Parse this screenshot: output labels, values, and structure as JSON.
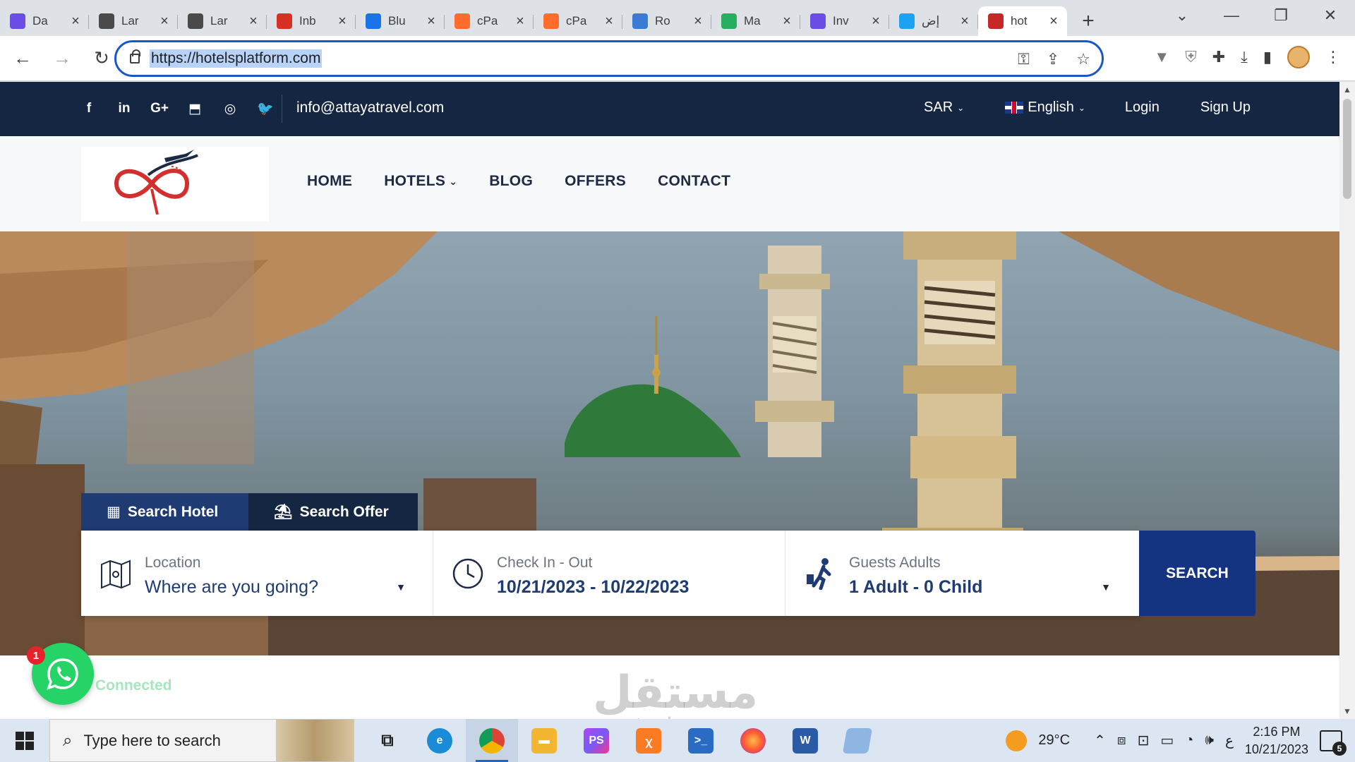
{
  "browser": {
    "tabs": [
      {
        "title": "Da",
        "icon": "heart-icon",
        "color": "#6b4de6"
      },
      {
        "title": "Lar",
        "icon": "openai-icon",
        "color": "#4a4a4a"
      },
      {
        "title": "Lar",
        "icon": "openai-icon",
        "color": "#4a4a4a"
      },
      {
        "title": "Inb",
        "icon": "gmail-icon",
        "color": "#d93025"
      },
      {
        "title": "Blu",
        "icon": "grid-icon",
        "color": "#1a73e8"
      },
      {
        "title": "cPa",
        "icon": "cpanel-icon",
        "color": "#ff6c2c"
      },
      {
        "title": "cPa",
        "icon": "cpanel-icon",
        "color": "#ff6c2c"
      },
      {
        "title": "Ro",
        "icon": "cube-icon",
        "color": "#3a7bd5"
      },
      {
        "title": "Ma",
        "icon": "mail-icon",
        "color": "#27ae60"
      },
      {
        "title": "Inv",
        "icon": "heart-icon",
        "color": "#6b4de6"
      },
      {
        "title": "إض",
        "icon": "circle-icon",
        "color": "#1da1f2"
      },
      {
        "title": "hot",
        "icon": "site-logo-icon",
        "color": "#c62828",
        "active": true
      }
    ],
    "url": "https://hotelsplatform.com"
  },
  "topbar": {
    "social": [
      "f",
      "in",
      "G+",
      "⬒",
      "◎",
      "🐦"
    ],
    "email": "info@attayatravel.com",
    "currency": "SAR",
    "language": "English",
    "login": "Login",
    "signup": "Sign Up"
  },
  "nav": {
    "items": [
      "HOME",
      "HOTELS",
      "BLOG",
      "OFFERS",
      "CONTACT"
    ]
  },
  "search": {
    "tab_hotel": "Search Hotel",
    "tab_offer": "Search Offer",
    "location_label": "Location",
    "location_value": "Where are you going?",
    "dates_label": "Check In - Out",
    "dates_value": "10/21/2023 - 10/22/2023",
    "guests_label": "Guests Adults",
    "guests_value": "1 Adult - 0 Child",
    "button": "SEARCH"
  },
  "whatsapp": {
    "badge": "1",
    "status": "Connected"
  },
  "watermark": {
    "line1": "مستقل",
    "line2": "mostaql.com"
  },
  "taskbar": {
    "search_placeholder": "Type here to search",
    "weather": "29°C",
    "lang": "ع",
    "time": "2:16 PM",
    "date": "10/21/2023",
    "notifications": "5"
  }
}
